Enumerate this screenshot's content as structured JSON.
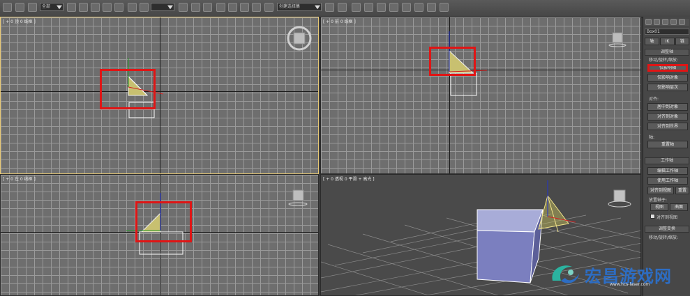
{
  "toolbar": {
    "selection_filter": "全部",
    "named_selection": "创建选择集"
  },
  "viewports": {
    "top": "[ + 0 顶 0 线框 ]",
    "front": "[ + 0 前 0 线框 ]",
    "left": "[ + 0 左 0 线框 ]",
    "perspective": "[ + 0 透视 0 平滑 + 高光 ]"
  },
  "command_panel": {
    "object_name": "Box01",
    "tab_labels": [
      "轴",
      "IK",
      "链"
    ],
    "adjust_pivot_rollout": "调整轴",
    "move_rotate_scale_label": "移动/旋转/缩放:",
    "affect_pivot_only": "仅影响轴",
    "affect_object_only": "仅影响对象",
    "affect_hierarchy_only": "仅影响层次",
    "alignment_label": "对齐:",
    "center_to_object": "居中到对象",
    "align_to_object": "对齐到对象",
    "align_to_world": "对齐到世界",
    "pivot_label": "轴:",
    "reset_pivot": "重置轴",
    "working_pivot_rollout": "工作轴",
    "edit_working_pivot": "编辑工作轴",
    "use_working_pivot": "使用工作轴",
    "align_to_view": "对齐到视图",
    "reset_short": "重置",
    "place_pivot_label": "放置轴于:",
    "view_btn": "视图",
    "surface_btn": "曲面",
    "align_to_view_check": "对齐到视图",
    "adjust_transform_rollout": "调整变换",
    "move_rotate_scale_label2": "移动/旋转/缩放:"
  },
  "watermark": {
    "brand": "宏昌游戏网",
    "url": "www.hcs-laser.com"
  },
  "colors": {
    "highlight_red": "#e01515",
    "active_viewport": "#e7c873",
    "box_fill": "#7b7fbf",
    "brand_blue": "#2d6dc3"
  }
}
